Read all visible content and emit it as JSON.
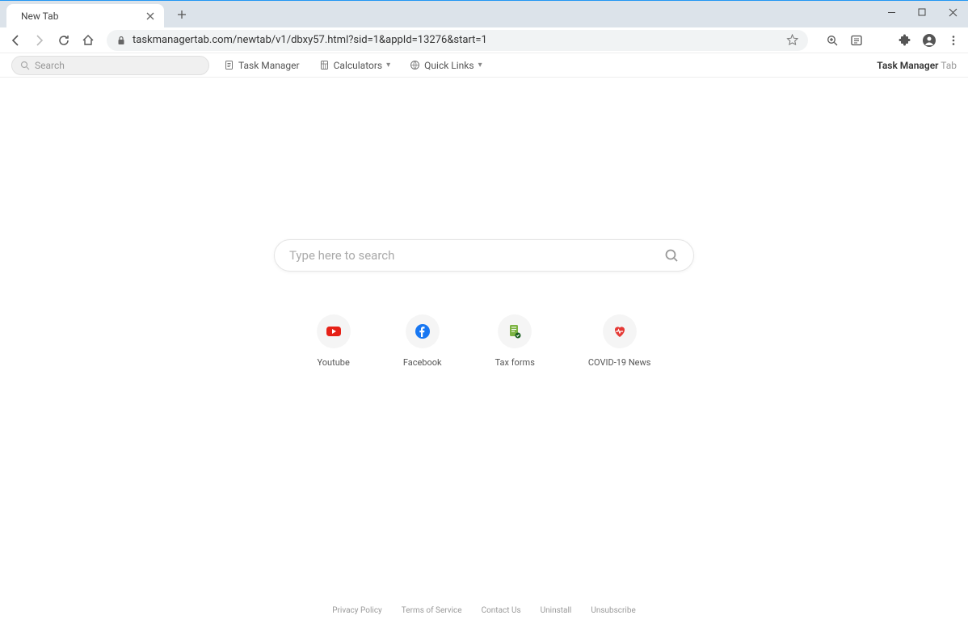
{
  "window": {
    "tab_title": "New Tab",
    "url": "taskmanagertab.com/newtab/v1/dbxy57.html?sid=1&appId=13276&start=1"
  },
  "toolbar": {
    "search_placeholder": "Search",
    "task_manager_label": "Task Manager",
    "calculators_label": "Calculators",
    "quick_links_label": "Quick Links",
    "brand_main": "Task Manager",
    "brand_suffix": " Tab"
  },
  "main": {
    "search_placeholder": "Type here to search"
  },
  "shortcuts": [
    {
      "label": "Youtube",
      "icon": "youtube"
    },
    {
      "label": "Facebook",
      "icon": "facebook"
    },
    {
      "label": "Tax forms",
      "icon": "taxforms"
    },
    {
      "label": "COVID-19 News",
      "icon": "covid"
    }
  ],
  "footer": {
    "links": [
      "Privacy Policy",
      "Terms of Service",
      "Contact Us",
      "Uninstall",
      "Unsubscribe"
    ]
  }
}
